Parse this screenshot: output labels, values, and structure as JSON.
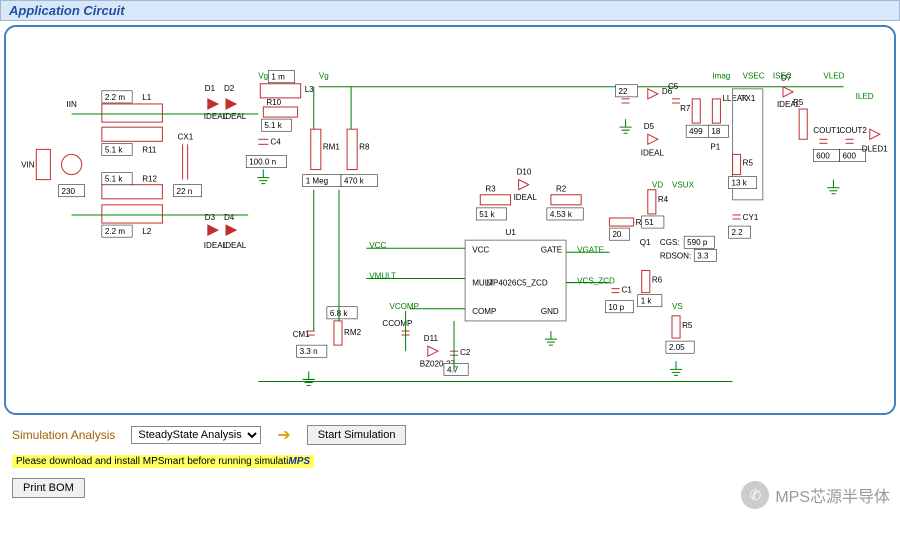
{
  "header": {
    "title": "Application Circuit"
  },
  "analysis": {
    "label": "Simulation Analysis",
    "selected": "SteadyState Analysis",
    "start_label": "Start Simulation"
  },
  "warning": {
    "text": "Please download and install MPSmart before running simulati",
    "brand": "MPS"
  },
  "print_btn": "Print BOM",
  "wechat": {
    "handle": "MPS芯源半导体"
  },
  "ic": {
    "ref": "U1",
    "part": "MP4026C5_ZCD",
    "pins": {
      "vcc": "VCC",
      "gate": "GATE",
      "mult": "MULT",
      "comp": "COMP",
      "gnd": "GND"
    }
  },
  "nodes": {
    "vin": "VIN",
    "iin": "IIN",
    "vg1": "Vg1",
    "vg": "Vg",
    "vcc": "VCC",
    "vmult": "VMULT",
    "vcomp": "VCOMP",
    "imag": "Imag",
    "vsec": "VSEC",
    "isec": "ISEC",
    "vgate": "VGATE",
    "vcs_zcd": "VCS_ZCD",
    "vled": "VLED",
    "iled": "ILED",
    "vd": "VD",
    "vsux": "VSUX",
    "vs": "VS",
    "q1": "Q1",
    "p1": "P1",
    "tx1": "TX1",
    "d1": "D1",
    "d2": "D2",
    "d3": "D3",
    "d4": "D4",
    "d5": "D5",
    "d6": "D6",
    "d7": "D7",
    "d10": "D10",
    "d11": "D11",
    "ideal": "IDEAL"
  },
  "comps": {
    "L1": "2.2 m",
    "L2": "2.2 m",
    "R11": "5.1 k",
    "R12": "5.1 k",
    "VIN_src": "230",
    "CX1": "22 n",
    "R10": "5.1 k",
    "L3": "1 m",
    "C4": "100.0 n",
    "RM1": "1 Meg",
    "R8": "470 k",
    "R3": "51 k",
    "R2": "4.53 k",
    "R9": "20",
    "R4": "51",
    "CGS": "590 p",
    "RDS": "3.3",
    "C1": "10 p",
    "R6": "1 k",
    "R5_vs": "2.05",
    "CM1": "3.3 n",
    "RM2": "6.8 k",
    "CCOMP": "",
    "C2": "4.7",
    "BZ": "BZ020-27",
    "C3": "22",
    "C5": "",
    "R7": "499",
    "LLEAK": "18",
    "R5": "13 k",
    "CY1": "2.2",
    "COUT1": "600",
    "COUT2": "600",
    "DLED1": "DLED1"
  }
}
